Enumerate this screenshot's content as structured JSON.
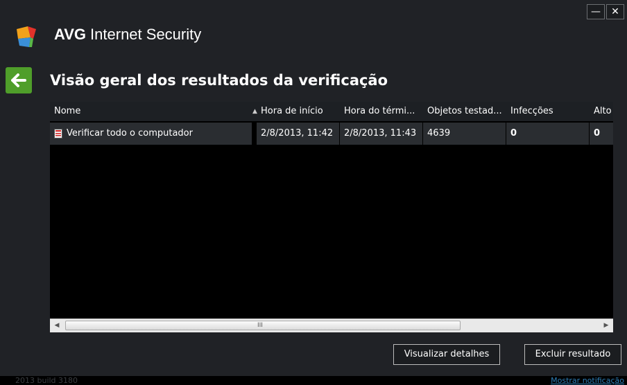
{
  "app": {
    "brand": "AVG",
    "product": "Internet Security"
  },
  "page": {
    "title": "Visão geral dos resultados da verificação"
  },
  "table": {
    "columns": [
      "Nome",
      "Hora de início",
      "Hora do térmi...",
      "Objetos testad...",
      "Infecções",
      "Alto"
    ],
    "sorted_column": "Hora de início",
    "rows": [
      {
        "icon": "scan-report-icon",
        "name": "Verificar todo o computador",
        "start": "2/8/2013, 11:42",
        "end": "2/8/2013, 11:43",
        "objects": "4639",
        "infections": "0",
        "high": "0"
      }
    ]
  },
  "buttons": {
    "view_details": "Visualizar detalhes",
    "delete_result": "Excluir resultado"
  },
  "footer": {
    "version": "2013  build 3180",
    "show_notification": "Mostrar notificação"
  },
  "colors": {
    "accent_green": "#4f9e2a",
    "link_blue": "#2d7fb8"
  }
}
